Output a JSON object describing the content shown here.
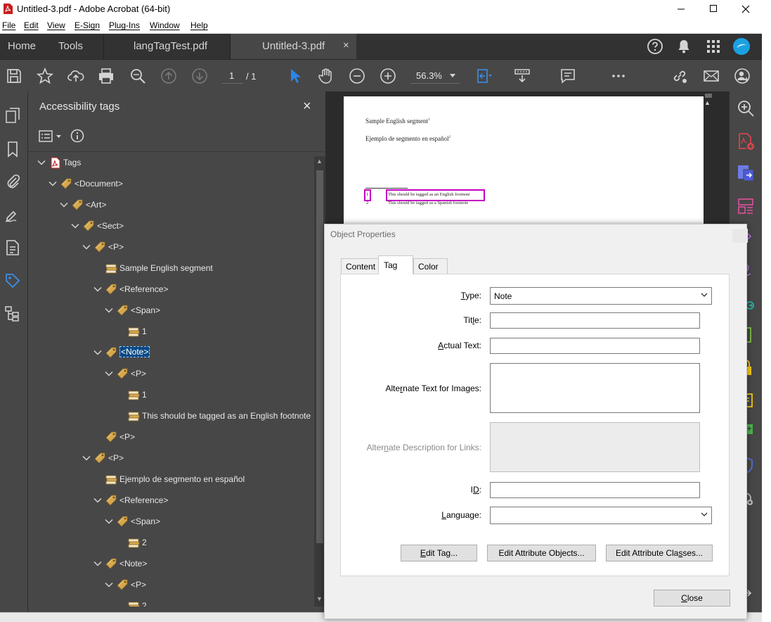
{
  "titlebar": {
    "title": "Untitled-3.pdf - Adobe Acrobat (64-bit)"
  },
  "menubar": {
    "items": [
      "File",
      "Edit",
      "View",
      "E-Sign",
      "Plug-Ins",
      "Window",
      "Help"
    ]
  },
  "tabbar": {
    "home": "Home",
    "tools": "Tools",
    "docs": [
      "langTagTest.pdf",
      "Untitled-3.pdf"
    ],
    "close_glyph": "×",
    "profile_color": "#1ba1e2"
  },
  "toolbar": {
    "page_current": "1",
    "page_total": "/ 1",
    "zoom": "56.3%"
  },
  "tags_panel": {
    "title": "Accessibility tags",
    "close_glyph": "×",
    "tree": [
      {
        "label": "Tags",
        "icon": "tags-root",
        "chevron": "down",
        "level": 0
      },
      {
        "label": "<Document>",
        "icon": "tag",
        "chevron": "down",
        "level": 1
      },
      {
        "label": "<Art>",
        "icon": "tag",
        "chevron": "down",
        "level": 2
      },
      {
        "label": "<Sect>",
        "icon": "tag",
        "chevron": "down",
        "level": 3
      },
      {
        "label": "<P>",
        "icon": "tag",
        "chevron": "down",
        "level": 4
      },
      {
        "label": "Sample English segment",
        "icon": "content",
        "chevron": "none",
        "level": 5
      },
      {
        "label": "<Reference>",
        "icon": "tag",
        "chevron": "down",
        "level": 5
      },
      {
        "label": "<Span>",
        "icon": "tag",
        "chevron": "down",
        "level": 6
      },
      {
        "label": "1",
        "icon": "content",
        "chevron": "none",
        "level": 7
      },
      {
        "label": "<Note>",
        "icon": "tag",
        "chevron": "down",
        "level": 5,
        "selected": true
      },
      {
        "label": "<P>",
        "icon": "tag",
        "chevron": "down",
        "level": 6
      },
      {
        "label": "1",
        "icon": "content",
        "chevron": "none",
        "level": 7
      },
      {
        "label": "This should be tagged as an English footnote",
        "icon": "content",
        "chevron": "none",
        "level": 7
      },
      {
        "label": "<P>",
        "icon": "tag",
        "chevron": "none",
        "level": 5
      },
      {
        "label": "<P>",
        "icon": "tag",
        "chevron": "down",
        "level": 4
      },
      {
        "label": "Ejemplo de segmento en español",
        "icon": "content",
        "chevron": "none",
        "level": 5
      },
      {
        "label": "<Reference>",
        "icon": "tag",
        "chevron": "down",
        "level": 5
      },
      {
        "label": "<Span>",
        "icon": "tag",
        "chevron": "down",
        "level": 6
      },
      {
        "label": "2",
        "icon": "content",
        "chevron": "none",
        "level": 7
      },
      {
        "label": "<Note>",
        "icon": "tag",
        "chevron": "down",
        "level": 5
      },
      {
        "label": "<P>",
        "icon": "tag",
        "chevron": "down",
        "level": 6
      },
      {
        "label": "2",
        "icon": "content",
        "chevron": "none",
        "level": 7
      }
    ]
  },
  "document": {
    "para1": "Sample English segment",
    "para1_sup": "1",
    "para2": "Ejemplo de segmento en español",
    "para2_sup": "2",
    "fn1_mark": "1",
    "fn1": "This should be tagged as an English footnote",
    "fn2_mark": "2",
    "fn2": "This should be tagged as a Spanish footnote",
    "highlight_color": "#c300c3"
  },
  "dialog": {
    "title": "Object Properties",
    "tabs": [
      "Content",
      "Tag",
      "Color"
    ],
    "active_tab": "Tag",
    "fields": {
      "type_label_pre": "",
      "type_label_ul": "T",
      "type_label_post": "ype:",
      "type_value": "Note",
      "title_label_pre": "Tit",
      "title_label_ul": "l",
      "title_label_post": "e:",
      "title_value": "",
      "actual_label_pre": "",
      "actual_label_ul": "A",
      "actual_label_post": "ctual Text:",
      "actual_value": "",
      "alt_label_pre": "Alte",
      "alt_label_ul": "r",
      "alt_label_post": "nate Text for Images:",
      "alt_value": "",
      "altdesc_label_pre": "Alter",
      "altdesc_label_ul": "n",
      "altdesc_label_post": "ate Description for Links:",
      "altdesc_value": "",
      "id_label_pre": "I",
      "id_label_ul": "D",
      "id_label_post": ":",
      "id_value": "",
      "lang_label_pre": "",
      "lang_label_ul": "L",
      "lang_label_post": "anguage:",
      "lang_value": ""
    },
    "buttons": {
      "edit_tag_pre": "",
      "edit_tag_ul": "E",
      "edit_tag_post": "dit Tag...",
      "edit_attr_objects": "Edit Attribute Objects...",
      "edit_attr_classes_pre": "Edit Attribute Cla",
      "edit_attr_classes_ul": "s",
      "edit_attr_classes_post": "ses...",
      "close_pre": "",
      "close_ul": "C",
      "close_post": "lose"
    }
  }
}
